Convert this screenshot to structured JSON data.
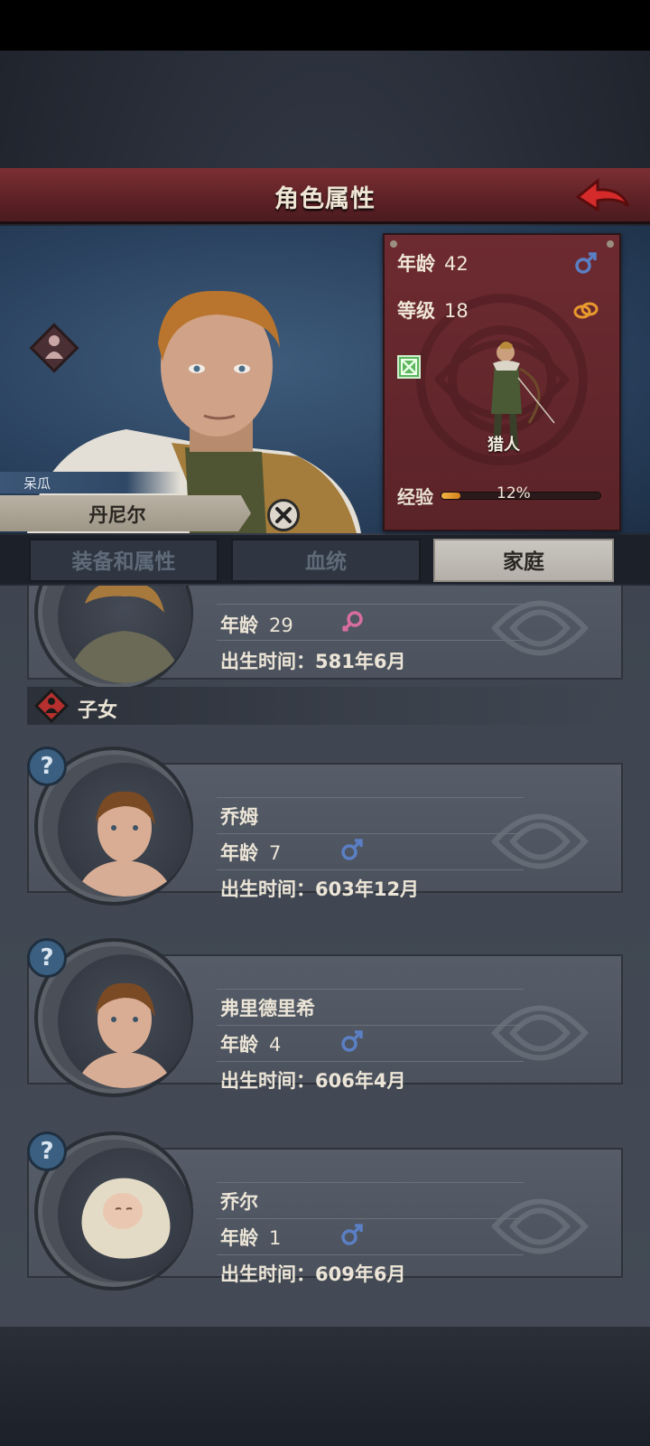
{
  "header": {
    "title": "角色属性"
  },
  "character": {
    "nickname": "呆瓜",
    "name": "丹尼尔",
    "age_label": "年龄",
    "age": "42",
    "level_label": "等级",
    "level": "18",
    "job": "猎人",
    "exp_label": "经验",
    "exp_percent": "12%",
    "exp_fraction": 0.12
  },
  "tabs": [
    {
      "label": "装备和属性",
      "active": false
    },
    {
      "label": "血统",
      "active": false
    },
    {
      "label": "家庭",
      "active": true
    }
  ],
  "family": {
    "spouse": {
      "age_label": "年龄",
      "age": "29",
      "birth_label": "出生时间：",
      "birth": "581年6月",
      "gender": "female"
    },
    "children_label": "子女",
    "children": [
      {
        "name": "乔姆",
        "age_label": "年龄",
        "age": "7",
        "birth_label": "出生时间：",
        "birth": "603年12月",
        "gender": "male",
        "help": "?"
      },
      {
        "name": "弗里德里希",
        "age_label": "年龄",
        "age": "4",
        "birth_label": "出生时间：",
        "birth": "606年4月",
        "gender": "male",
        "help": "?"
      },
      {
        "name": "乔尔",
        "age_label": "年龄",
        "age": "1",
        "birth_label": "出生时间：",
        "birth": "609年6月",
        "gender": "male",
        "help": "?"
      }
    ]
  },
  "colors": {
    "title_bar": "#6a262b",
    "accent_gold": "#e89a2e",
    "male_symbol": "#5b7fc4",
    "female_symbol": "#d86ea0"
  }
}
